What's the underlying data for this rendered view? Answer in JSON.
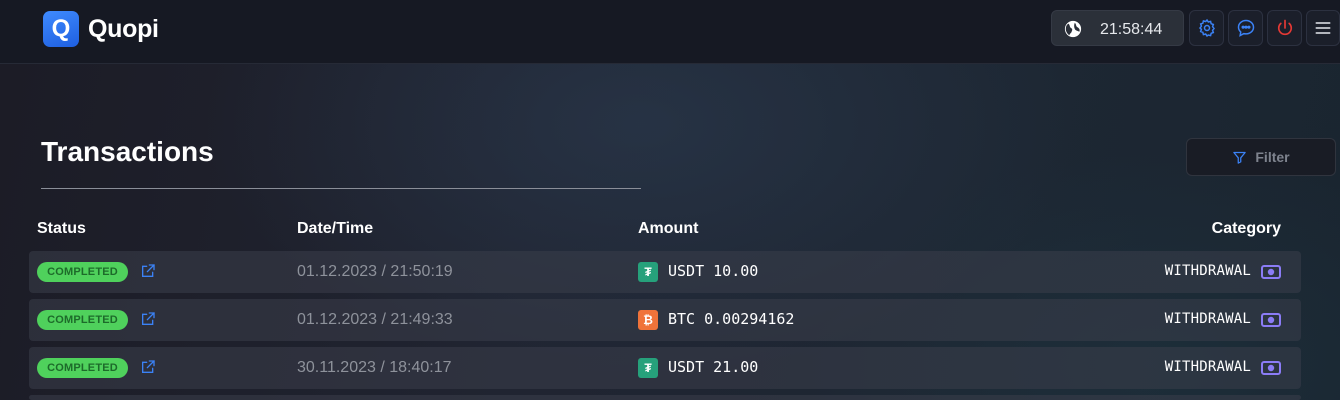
{
  "app": {
    "logo_letter": "Q",
    "name": "Quopi"
  },
  "header": {
    "time": "21:58:44",
    "icons": [
      "globe-icon",
      "gear-icon",
      "chat-icon",
      "power-icon",
      "menu-icon"
    ],
    "colors": {
      "gear": "#3b82f6",
      "chat": "#3b82f6",
      "power": "#e53935",
      "menu": "#c9ccd2"
    }
  },
  "page": {
    "title": "Transactions",
    "filter_label": "Filter"
  },
  "table": {
    "columns": {
      "status": "Status",
      "datetime": "Date/Time",
      "amount": "Amount",
      "category": "Category"
    },
    "rows": [
      {
        "status": "COMPLETED",
        "datetime": "01.12.2023 / 21:50:19",
        "coin_icon": "tether-icon",
        "amount": "USDT 10.00",
        "category": "WITHDRAWAL"
      },
      {
        "status": "COMPLETED",
        "datetime": "01.12.2023 / 21:49:33",
        "coin_icon": "bitcoin-icon",
        "amount": "BTC 0.00294162",
        "category": "WITHDRAWAL"
      },
      {
        "status": "COMPLETED",
        "datetime": "30.11.2023 / 18:40:17",
        "coin_icon": "tether-icon",
        "amount": "USDT 21.00",
        "category": "WITHDRAWAL"
      }
    ]
  },
  "colors": {
    "completed": "#4fd15c",
    "tether": "#26a17b",
    "bitcoin": "#f0733a",
    "category_icon": "#8b7cf6",
    "link": "#3b82f6"
  }
}
